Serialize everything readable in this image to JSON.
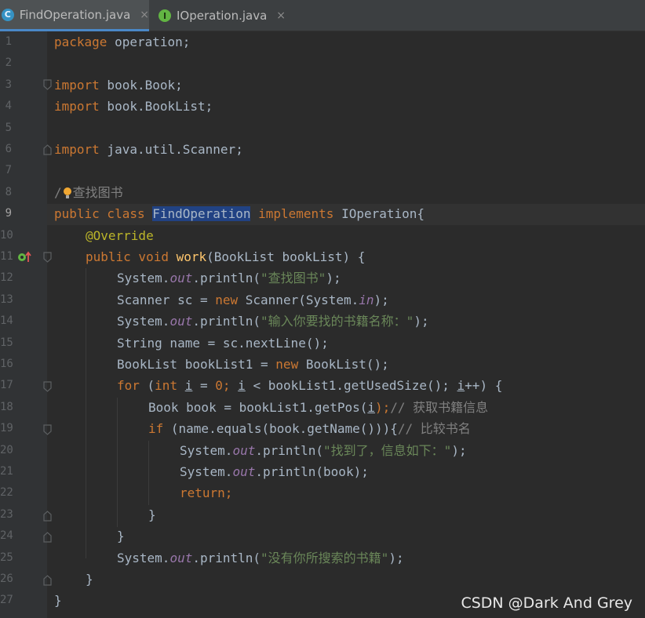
{
  "tabs": [
    {
      "label": "FindOperation.java",
      "icon": "C",
      "icon_color": "#3592c4",
      "active": true
    },
    {
      "label": "IOperation.java",
      "icon": "I",
      "icon_color": "#62b543",
      "active": false
    }
  ],
  "close_glyph": "×",
  "line_numbers": [
    "1",
    "2",
    "3",
    "4",
    "5",
    "6",
    "7",
    "8",
    "9",
    "10",
    "11",
    "12",
    "13",
    "14",
    "15",
    "16",
    "17",
    "18",
    "19",
    "20",
    "21",
    "22",
    "23",
    "24",
    "25",
    "26",
    "27"
  ],
  "code": {
    "l1_kw": "package",
    "l1_rest": " operation;",
    "l3_kw": "import",
    "l3_rest": " book.Book;",
    "l4_kw": "import",
    "l4_rest": " book.BookList;",
    "l6_kw": "import",
    "l6_rest": " java.util.Scanner;",
    "l8_slash": "/",
    "l8_comment": "查找图书",
    "l9_kw": "public class ",
    "l9_cls": "FindOperation",
    "l9_kw2": " implements ",
    "l9_rest": "IOperation{",
    "l10_ann": "@Override",
    "l11_kw": "public void ",
    "l11_fn": "work",
    "l11_rest": "(BookList bookList) {",
    "l12_a": "System.",
    "l12_out": "out",
    "l12_b": ".println(",
    "l12_str": "\"查找图书\"",
    "l12_c": ");",
    "l13_a": "Scanner sc = ",
    "l13_kw": "new",
    "l13_b": " Scanner(System.",
    "l13_in": "in",
    "l13_c": ");",
    "l14_a": "System.",
    "l14_out": "out",
    "l14_b": ".println(",
    "l14_str": "\"输入你要找的书籍名称：\"",
    "l14_c": ");",
    "l15": "String name = sc.nextLine();",
    "l16_a": "BookList bookList1 = ",
    "l16_kw": "new",
    "l16_b": " BookList();",
    "l17_kw": "for",
    "l17_a": " (",
    "l17_int": "int",
    "l17_b": " ",
    "l17_i1": "i",
    "l17_c": " = ",
    "l17_zero": "0",
    "l17_d": "; ",
    "l17_i2": "i",
    "l17_e": " < bookList1.getUsedSize(); ",
    "l17_i3": "i",
    "l17_f": "++) {",
    "l18_a": "Book book = bookList1.getPos(",
    "l18_i": "i",
    "l18_b": ");",
    "l18_cm": "// 获取书籍信息",
    "l19_kw": "if",
    "l19_a": " (name.equals(book.getName())){",
    "l19_cm": "// 比较书名",
    "l20_a": "System.",
    "l20_out": "out",
    "l20_b": ".println(",
    "l20_str": "\"找到了，信息如下：\"",
    "l20_c": ");",
    "l21_a": "System.",
    "l21_out": "out",
    "l21_b": ".println(book);",
    "l22_kw": "return",
    "l22_a": ";",
    "l23": "}",
    "l24": "}",
    "l25_a": "System.",
    "l25_out": "out",
    "l25_b": ".println(",
    "l25_str": "\"没有你所搜索的书籍\"",
    "l25_c": ");",
    "l26": "}",
    "l27": "}"
  },
  "watermark": "CSDN @Dark And Grey",
  "colors": {
    "keyword": "#cc7832",
    "string": "#6a8759",
    "annotation": "#bbb529",
    "method": "#ffc66d",
    "static_field": "#9876aa",
    "comment": "#808080",
    "text": "#a9b7c6",
    "selection": "#214283"
  }
}
